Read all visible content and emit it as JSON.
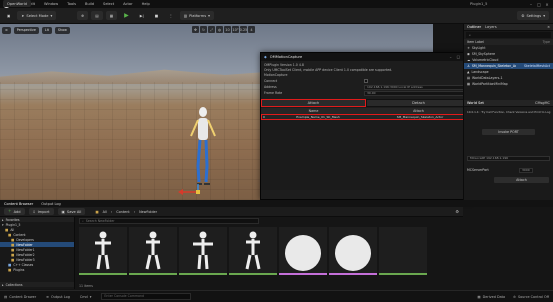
{
  "window": {
    "title": "Plugin1_5",
    "project_tab": "OpenWorld"
  },
  "menu": [
    "File",
    "Edit",
    "Window",
    "Tools",
    "Build",
    "Select",
    "Actor",
    "Help"
  ],
  "toolbar": {
    "mode": "Select Mode",
    "platforms": "Platforms",
    "settings": "Settings"
  },
  "viewport": {
    "chips": [
      "Perspective",
      "Lit",
      "Show"
    ],
    "tool_values": [
      "10",
      "10°",
      "0.25",
      "4"
    ]
  },
  "outliner": {
    "tabs": [
      "Outliner",
      "Layers"
    ],
    "col_label": "Item Label",
    "col_type": "Type",
    "rows": [
      {
        "label": "SkyLight",
        "type": ""
      },
      {
        "label": "SM_SkySphere",
        "type": ""
      },
      {
        "label": "VolumetricCloud",
        "type": ""
      },
      {
        "label": "SM_Mannequin_Skeleton_Actor",
        "type": "SkeletalMeshActor",
        "selected": true
      },
      {
        "label": "Landscape",
        "type": ""
      },
      {
        "label": "WorldDataLayers-1",
        "type": ""
      },
      {
        "label": "WorldPartitionMiniMap",
        "type": ""
      }
    ]
  },
  "details": {
    "tabs": [
      "World Set",
      "CMsgMC"
    ],
    "lines": [
      "10.0.1.4 : Try Call Function, Check Versions and Print to Log"
    ],
    "buttons": [
      "Invoke PORT",
      "MCLocalIP 192.168.1.196",
      "Attach"
    ],
    "port_label": "MCServerPort",
    "port_value": "3000"
  },
  "plugin": {
    "title": "OMMotionCapture",
    "lines": [
      "OMPlugin Version 1.0 4.8",
      "Only UMCToolSet Client, mobile APP device Client 1.0 compatible are supported.",
      "MotionCapture"
    ],
    "fields": [
      {
        "label": "Connect",
        "value": ""
      },
      {
        "label": "Address",
        "value": "192.168.1.196:3000  Local IP address"
      },
      {
        "label": "Frame Rate",
        "value": "30.00"
      }
    ],
    "attach_button": "Attach",
    "detach_button": "Detach",
    "table_headers": [
      "Name",
      "Attach"
    ],
    "table_row": {
      "index": "0",
      "name": "Example_Name_01_SK_Mesh",
      "attach": "SM_Mannequin_Skeleton_Actor"
    }
  },
  "content_browser": {
    "tabs": [
      "Content Browser",
      "Output Log"
    ],
    "toolbar": {
      "add": "Add",
      "import": "Import",
      "save_all": "Save All",
      "path": [
        "All",
        "Content",
        "NewFolder"
      ],
      "search_placeholder": "Search NewFolder"
    },
    "tree_header": "Favorites",
    "tree": [
      {
        "label": "Plugin1_5",
        "depth": 0
      },
      {
        "label": "All",
        "depth": 1
      },
      {
        "label": "Content",
        "depth": 2
      },
      {
        "label": "Developers",
        "depth": 3
      },
      {
        "label": "NewFolder",
        "depth": 3,
        "selected": true
      },
      {
        "label": "NewFolder1",
        "depth": 3
      },
      {
        "label": "NewFolder2",
        "depth": 3
      },
      {
        "label": "NewFolder3",
        "depth": 3
      },
      {
        "label": "C++ Classes",
        "depth": 2
      },
      {
        "label": "Plugins",
        "depth": 2
      }
    ],
    "collections": "Collections",
    "item_count": "11 items"
  },
  "status": {
    "left": [
      "Content Drawer",
      "Output Log",
      "Cmd"
    ],
    "cmd_placeholder": "Enter Console Command",
    "right": [
      "Derived Data",
      "Source Control Off"
    ]
  }
}
